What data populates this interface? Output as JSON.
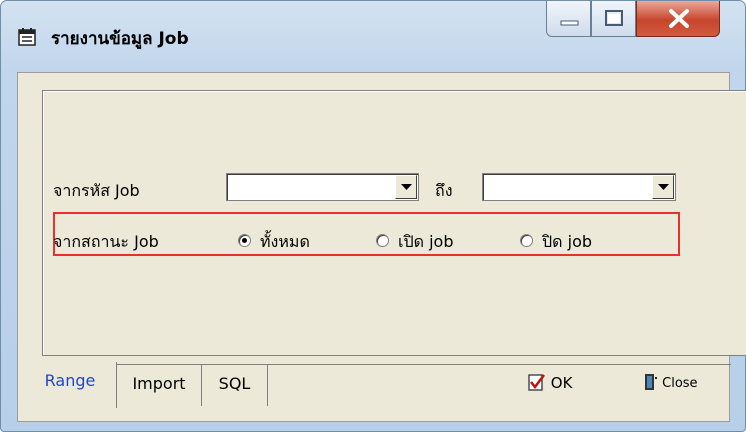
{
  "window": {
    "title": "รายงานข้อมูล Job",
    "controls": {
      "minimize": "minimize-icon",
      "maximize": "maximize-icon",
      "close": "close-icon"
    }
  },
  "form": {
    "job_code_from_label": "จากรหัส Job",
    "job_code_to_label": "ถึง",
    "job_code_from_value": "",
    "job_code_to_value": "",
    "status_label": "จากสถานะ Job",
    "status_options": [
      {
        "label": "ทั้งหมด",
        "selected": true
      },
      {
        "label": "เปิด job",
        "selected": false
      },
      {
        "label": "ปิด job",
        "selected": false
      }
    ]
  },
  "tabs": [
    {
      "label": "Range",
      "active": true
    },
    {
      "label": "Import",
      "active": false
    },
    {
      "label": "SQL",
      "active": false
    }
  ],
  "actions": {
    "ok_label": "OK",
    "close_label": "Close"
  },
  "colors": {
    "highlight_border": "#e8302c",
    "active_tab_text": "#1f47c6"
  }
}
